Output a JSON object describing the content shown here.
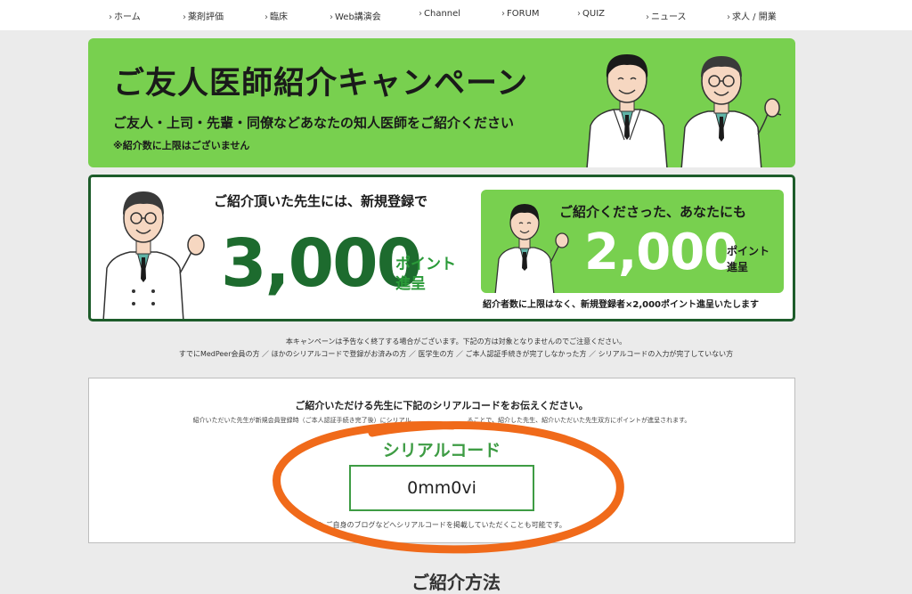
{
  "nav": {
    "items": [
      "ホーム",
      "薬剤評価",
      "臨床",
      "Web講演会",
      "Channel",
      "FORUM",
      "QUIZ",
      "ニュース",
      "求人 / 開業"
    ]
  },
  "banner": {
    "title": "ご友人医師紹介キャンペーン",
    "subtitle": "ご友人・上司・先輩・同僚などあなたの知人医師をご紹介ください",
    "note": "※紹介数に上限はございません"
  },
  "reward": {
    "friend_heading": "ご紹介頂いた先生には、新規登録で",
    "friend_points": "3,000",
    "friend_unit_line1": "ポイント",
    "friend_unit_line2": "進呈",
    "you_heading": "ご紹介くださった、あなたにも",
    "you_points": "2,000",
    "you_unit_line1": "ポイント",
    "you_unit_line2": "進呈",
    "limit_note": "紹介者数に上限はなく、新規登録者×2,000ポイント進呈いたします"
  },
  "notice": {
    "line1": "本キャンペーンは予告なく終了する場合がございます。下記の方は対象となりませんのでご注意ください。",
    "line2": "すでにMedPeer会員の方 ／ ほかのシリアルコードで登録がお済みの方 ／ 医学生の方 ／ ご本人認証手続きが完了しなかった方 ／ シリアルコードの入力が完了していない方"
  },
  "serial": {
    "heading": "ご紹介いただける先生に下記のシリアルコードをお伝えください。",
    "description": "紹介いただいた先生が新規会員登録時（ご本人認証手続き完了後）にシリアル　　　　　　　　　ることで、紹介した先生、紹介いただいた先生双方にポイントが進呈されます。",
    "label": "シリアルコード",
    "code": "0mm0vi",
    "footnote": "※ ご自身のブログなどへシリアルコードを掲載していただくことも可能です。"
  },
  "section": {
    "title": "ご紹介方法"
  },
  "colors": {
    "banner_green": "#78d04f",
    "dark_green": "#1d6b2e",
    "accent_green": "#3e9c44",
    "annotation_orange": "#f06a1a"
  }
}
